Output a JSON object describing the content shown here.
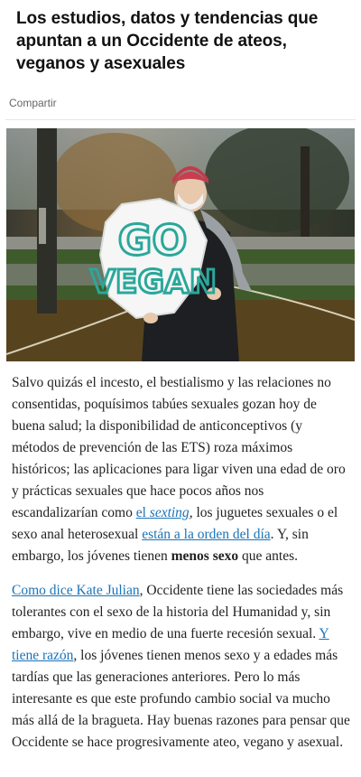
{
  "article": {
    "title": "Los estudios, datos y tendencias que apuntan a un Occidente de ateos, veganos y asexuales",
    "share_label": "Compartir",
    "image": {
      "sign_text_line1": "GO",
      "sign_text_line2": "VEGAN"
    },
    "paragraph1": {
      "t1": "Salvo quizás el incesto, el bestialismo y las relaciones no consentidas, poquísimos tabúes sexuales gozan hoy de buena salud; la disponibilidad de anticonceptivos (y métodos de prevención de las ETS) roza máximos históricos; las aplicaciones para ligar viven una edad de oro y prácticas sexuales que hace pocos años nos escandalizarían como ",
      "link1_pre": "el ",
      "link1_em": "sexting",
      "t2": ", los juguetes sexuales o el sexo anal heterosexual ",
      "link2": "están a la orden del día",
      "t3": ". Y, sin embargo, los jóvenes tienen ",
      "bold": "menos sexo",
      "t4": " que antes."
    },
    "paragraph2": {
      "link1": "Como dice Kate Julian",
      "t1": ", Occidente tiene las sociedades más tolerantes con el sexo de la historia del Humanidad y, sin embargo, vive en medio de una fuerte recesión sexual. ",
      "link2": "Y tiene razón",
      "t2": ", los jóvenes tienen menos sexo y a edades más tardías que las generaciones anteriores. Pero lo más interesante es que este profundo cambio social va mucho más allá de la bragueta. Hay buenas razones para pensar que Occidente se hace progresivamente ateo, vegano y asexual."
    }
  }
}
